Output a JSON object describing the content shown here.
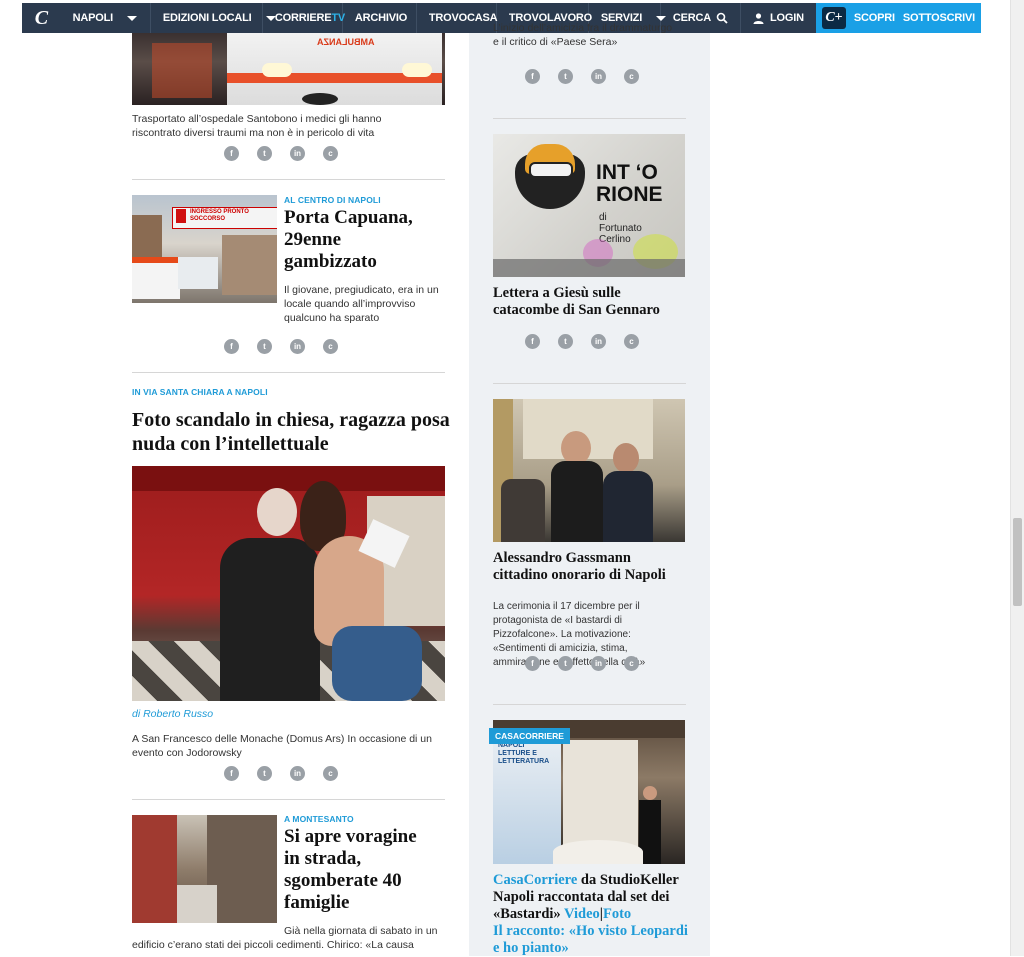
{
  "nav": {
    "logo": "C",
    "items": [
      {
        "label": "NAPOLI",
        "caret": true
      },
      {
        "label": "EDIZIONI LOCALI",
        "caret": true
      },
      {
        "label": "CORRIERE",
        "suffix": "TV",
        "caret": false
      },
      {
        "label": "ARCHIVIO",
        "caret": false
      },
      {
        "label": "TROVOCASA",
        "caret": false
      },
      {
        "label": "TROVOLAVORO",
        "caret": false
      },
      {
        "label": "SERVIZI",
        "caret": true
      },
      {
        "label": "CERCA",
        "caret": false
      }
    ],
    "login": "LOGIN",
    "cplus": "C+",
    "discover": "SCOPRI",
    "subscribe": "SOTTOSCRIVI"
  },
  "left": {
    "article1": {
      "caption": "Trasportato all’ospedale Santobono i medici gli hanno riscontrato diversi traumi ma non è in pericolo di vita",
      "image_text": "AMBULANZA"
    },
    "article2": {
      "kicker": "AL CENTRO DI NAPOLI",
      "title": "Porta Capuana, 29enne gambizzato",
      "summary": "Il giovane, pregiudicato, era in un locale quando all’improvviso qualcuno ha sparato",
      "image_text": "INGRESSO PRONTO SOCCORSO"
    },
    "article3": {
      "kicker": "IN VIA SANTA CHIARA A NAPOLI",
      "title": "Foto scandalo in chiesa, ragazza posa nuda con l’intellettuale",
      "byline": "di Roberto Russo",
      "summary": "A San Francesco delle Monache (Domus Ars) In occasione di un evento con Jodorowsky"
    },
    "article4": {
      "kicker": "A MONTESANTO",
      "title": "Si apre voragine in strada, sgomberate 40 famiglie",
      "summary": "Già nella giornata di sabato in un edificio c’erano stati dei piccoli cedimenti. Chirico: «La causa potrebbe essere una"
    }
  },
  "right": {
    "top_fragment": "L’inizio dell’amicizia fra il drammaturgo e il critico di «Paese Sera»",
    "card1": {
      "title": "Lettera a Giesù sulle catacombe di San Gennaro",
      "banner_line1": "INT ‘O",
      "banner_line2": "RIONE",
      "banner_by": "di",
      "banner_author1": "Fortunato",
      "banner_author2": "Cerlino"
    },
    "card2": {
      "title": "Alessandro Gassmann cittadino onorario di Napoli",
      "summary": "La cerimonia il 17 dicembre per il protagonista de «I bastardi di Pizzofalcone». La motivazione: «Sentimenti di amicizia, stima, ammirazione ed affetto della città»"
    },
    "card3": {
      "badge": "CASACORRIERE",
      "t_link1": "CasaCorriere",
      "t_text1": " da StudioKeller Napoli raccontata dal set dei «Bastardi» ",
      "t_link2": "Video",
      "t_sep": "|",
      "t_link3": "Foto",
      "t_link4": "Il racconto: «Ho visto Leopardi e ho pianto»",
      "image_text": "NAPOLI LETTURE E LETTERATURA"
    }
  },
  "social": {
    "facebook": "f",
    "twitter": "t",
    "linkedin": "in",
    "comment": "c"
  },
  "colors": {
    "nav_bg": "#2b3a4e",
    "accent": "#1f9bd7",
    "right_bg": "#eef1f4"
  }
}
